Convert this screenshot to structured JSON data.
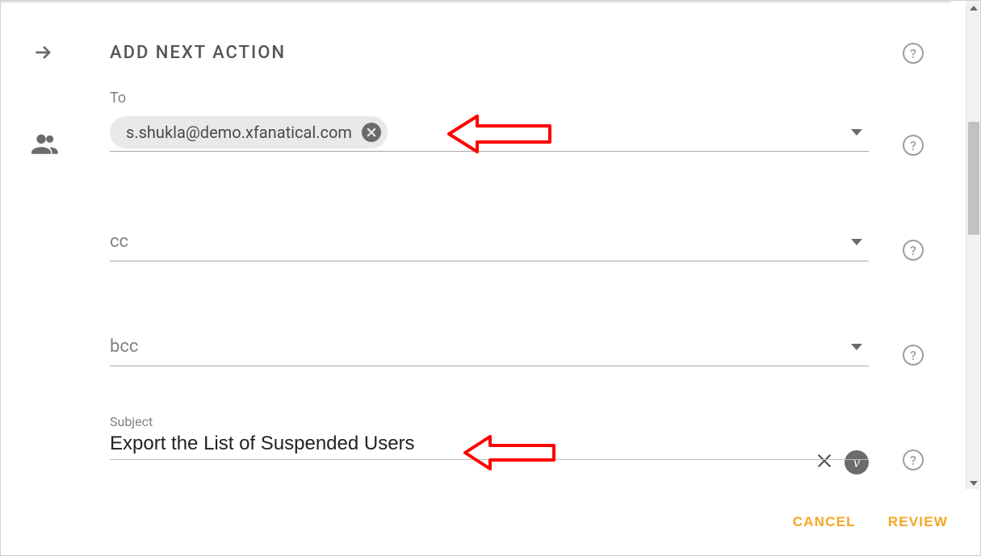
{
  "heading": "ADD NEXT ACTION",
  "fields": {
    "to": {
      "label": "To",
      "chip_email": "s.shukla@demo.xfanatical.com"
    },
    "cc": {
      "label": "cc"
    },
    "bcc": {
      "label": "bcc"
    },
    "subject": {
      "label": "Subject",
      "value": "Export the List of Suspended Users"
    }
  },
  "variable_badge": "v",
  "footer": {
    "cancel": "CANCEL",
    "review": "REVIEW"
  }
}
